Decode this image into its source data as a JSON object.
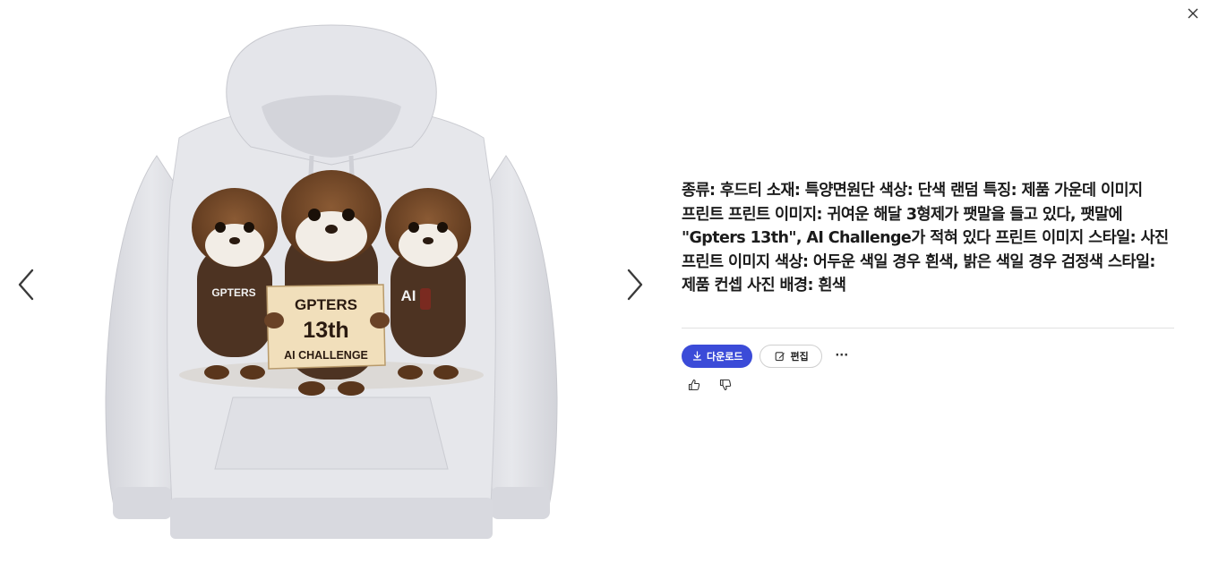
{
  "viewer": {
    "close_icon": "close-icon",
    "prev_icon": "chevron-left-icon",
    "next_icon": "chevron-right-icon"
  },
  "image": {
    "sign_line1": "GPTERS",
    "sign_line2": "13th",
    "sign_line3": "AI CHALLENGE",
    "left_hoodie_text": "GPTERS",
    "right_hoodie_text": "AI",
    "garment_color": "#e3e4e9"
  },
  "info": {
    "description": "종류: 후드티 소재: 특양면원단 색상: 단색 랜덤 특징: 제품 가운데 이미지 프린트 프린트 이미지: 귀여운 해달 3형제가 팻말을 들고 있다, 팻말에 \"Gpters 13th\", AI Challenge가 적혀 있다 프린트 이미지 스타일: 사진 프린트 이미지 색상: 어두운 색일 경우 흰색, 밝은 색일 경우 검정색 스타일: 제품 컨셉 사진 배경: 흰색",
    "download_label": "다운로드",
    "edit_label": "편집",
    "more_label": "···"
  },
  "colors": {
    "accent": "#3b4bd8",
    "divider": "#e1e1e1"
  }
}
